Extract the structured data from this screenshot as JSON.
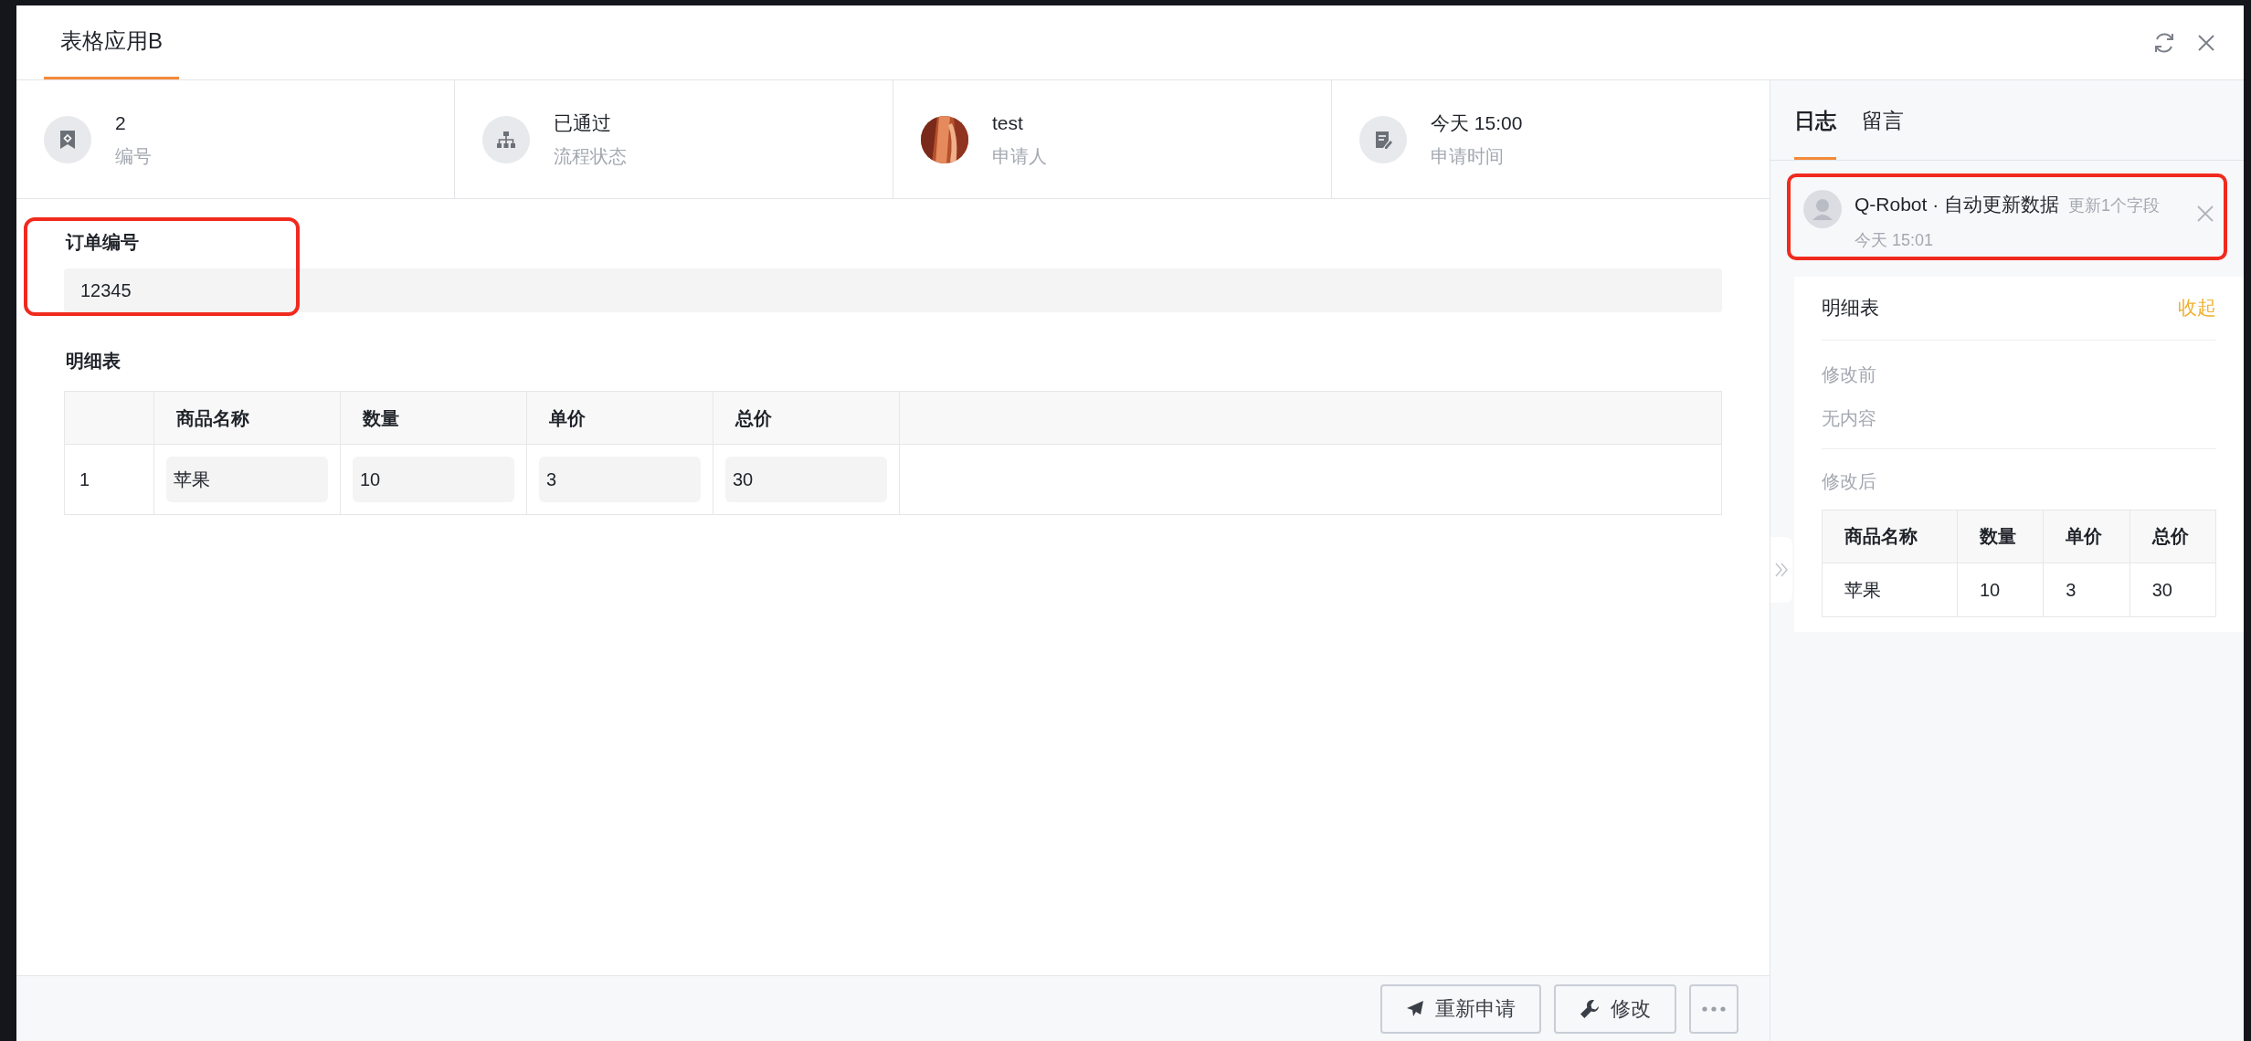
{
  "window": {
    "title": "表格应用B"
  },
  "info": [
    {
      "kind": "number",
      "value": "2",
      "label": "编号"
    },
    {
      "kind": "status",
      "value": "已通过",
      "label": "流程状态"
    },
    {
      "kind": "applicant",
      "value": "test",
      "label": "申请人"
    },
    {
      "kind": "time",
      "value": "今天 15:00",
      "label": "申请时间"
    }
  ],
  "form": {
    "order_label": "订单编号",
    "order_value": "12345",
    "detail_label": "明细表",
    "columns": [
      "商品名称",
      "数量",
      "单价",
      "总价"
    ],
    "rows": [
      {
        "index": "1",
        "cells": [
          "苹果",
          "10",
          "3",
          "30"
        ]
      }
    ]
  },
  "actions": [
    {
      "kind": "send",
      "label": "重新申请"
    },
    {
      "kind": "edit",
      "label": "修改"
    },
    {
      "kind": "more"
    }
  ],
  "side": {
    "tabs": [
      {
        "label": "日志",
        "selected": true
      },
      {
        "label": "留言",
        "selected": false
      }
    ],
    "log": {
      "actor": "Q-Robot · 自动更新数据",
      "summary": "更新1个字段",
      "time": "今天 15:01"
    },
    "detail": {
      "title": "明细表",
      "toggle": "收起",
      "before_label": "修改前",
      "before_value": "无内容",
      "after_label": "修改后",
      "columns": [
        "商品名称",
        "数量",
        "单价",
        "总价"
      ],
      "rows": [
        [
          "苹果",
          "10",
          "3",
          "30"
        ]
      ]
    }
  }
}
